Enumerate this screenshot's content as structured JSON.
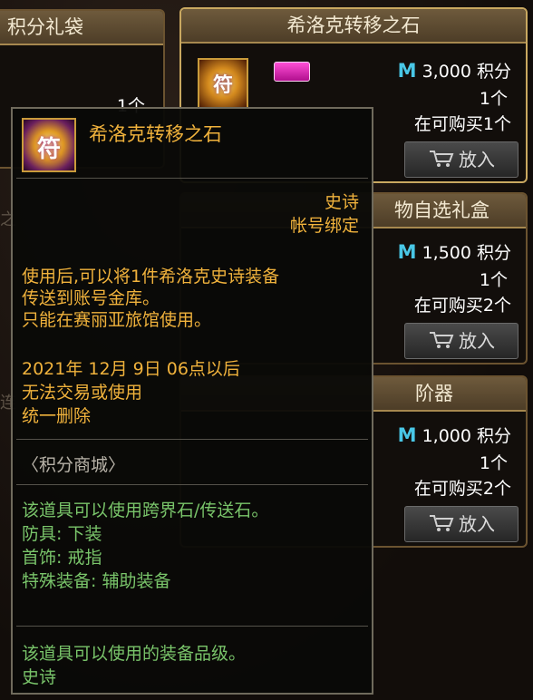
{
  "bg_cards": {
    "top_left_title": "积分礼袋",
    "top_left_qty": "1个",
    "mid_left_fragment": "之",
    "bottom_left_fragment": "连"
  },
  "card1": {
    "title": "希洛克转移之石",
    "badge": "epic",
    "currency_icon": "M",
    "price": "3,000 积分",
    "qty": "1个",
    "limit": "在可购买1个",
    "put_label": "放入"
  },
  "card2": {
    "title": "物自选礼盒",
    "currency_icon": "M",
    "price": "1,500 积分",
    "qty": "1个",
    "limit": "在可购买2个",
    "put_label": "放入"
  },
  "card3": {
    "title": "阶器",
    "currency_icon": "M",
    "price": "1,000 积分",
    "qty": "1个",
    "limit": "在可购买2个",
    "put_label": "放入"
  },
  "tooltip": {
    "title": "希洛克转移之石",
    "grade": "史诗",
    "binding": "帐号绑定",
    "desc": [
      "使用后,可以将1件希洛克史诗装备",
      "传送到账号金库。",
      "只能在赛丽亚旅馆使用。"
    ],
    "expire": [
      "2021年 12月 9日 06点以后",
      "无法交易或使用",
      "统一删除"
    ],
    "source": "〈积分商城〉",
    "usable": [
      "该道具可以使用跨界石/传送石。",
      "防具: 下装",
      "首饰: 戒指",
      "特殊装备: 辅助装备"
    ],
    "grade_note": [
      "该道具可以使用的装备品级。",
      "史诗"
    ]
  },
  "colors": {
    "orange": "#f0b23c",
    "green": "#79c46a",
    "currency": "#49c7e6",
    "epic_badge": "#e23bbd"
  }
}
